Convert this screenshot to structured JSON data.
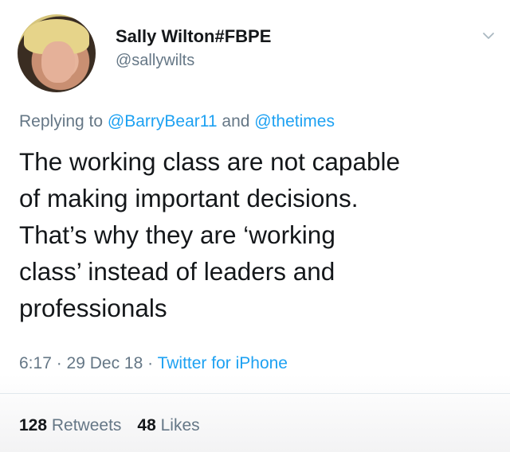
{
  "user": {
    "display_name": "Sally Wilton#FBPE",
    "handle": "@sallywilts"
  },
  "reply": {
    "prefix": "Replying to ",
    "mention_1": "@BarryBear11",
    "conjunction": " and ",
    "mention_2": "@thetimes"
  },
  "tweet": {
    "lines": [
      "The working class are not capable",
      "of making important decisions.",
      "That’s why they are ‘working",
      "class’ instead of leaders and",
      "professionals"
    ]
  },
  "meta": {
    "time": "6:17",
    "separator": " · ",
    "date": "29 Dec 18",
    "source": "Twitter for iPhone"
  },
  "stats": {
    "retweets_count": "128",
    "retweets_label": " Retweets",
    "likes_count": "48",
    "likes_label": " Likes"
  },
  "icons": {
    "menu": "chevron-down-icon"
  },
  "colors": {
    "link": "#1da1f2",
    "secondary_text": "#657786",
    "primary_text": "#14171a"
  }
}
